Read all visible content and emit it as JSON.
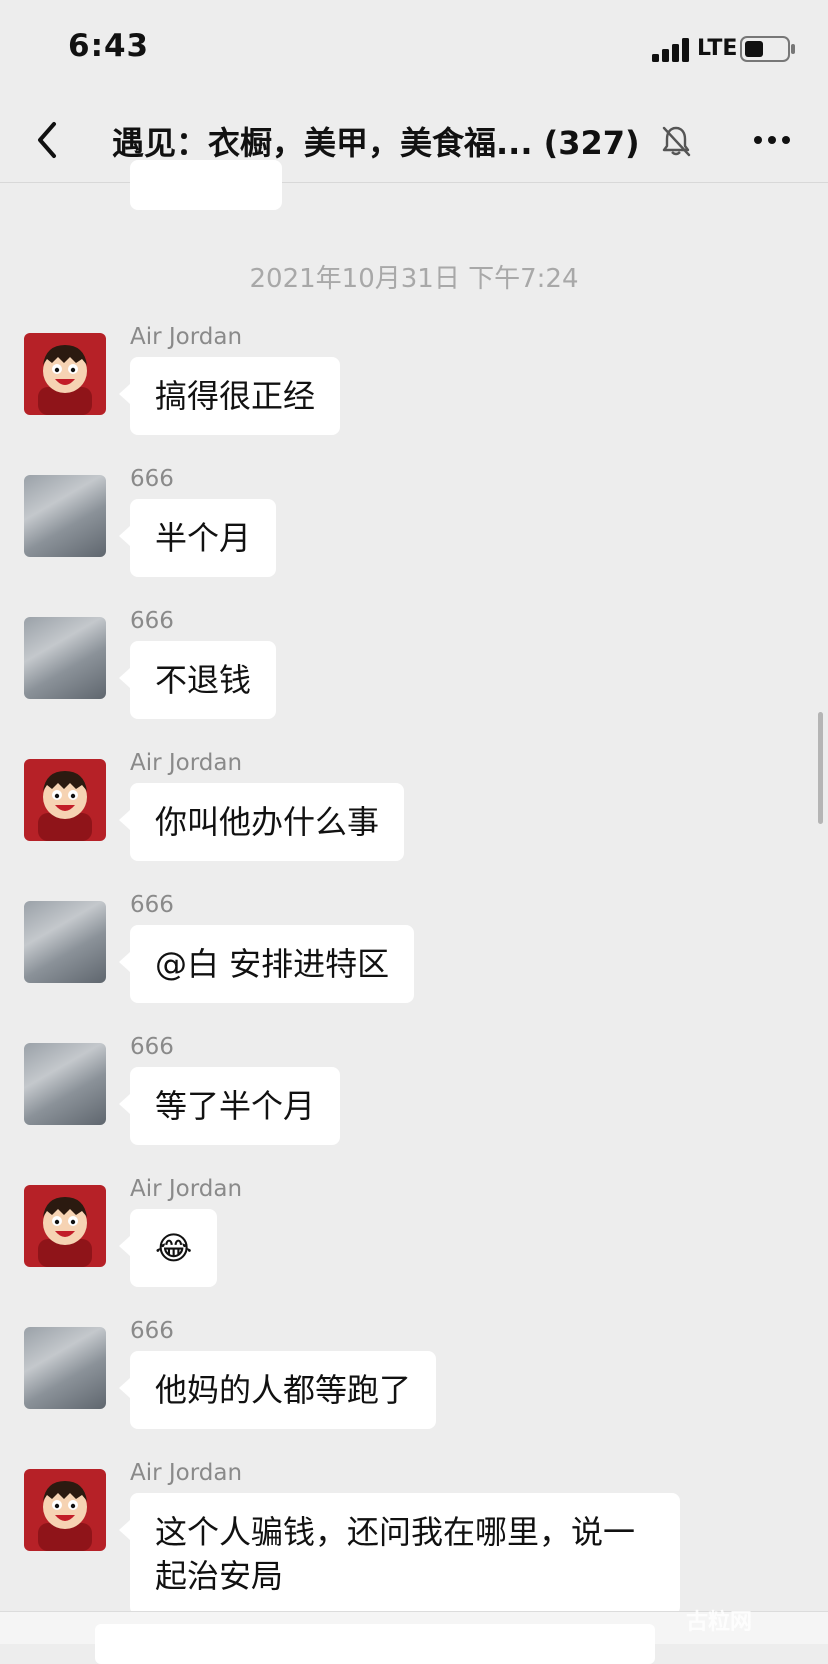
{
  "status_bar": {
    "time": "6:43",
    "network": "LTE",
    "signal_icon": "signal-bars-icon",
    "battery_icon": "battery-icon"
  },
  "nav": {
    "back_icon": "chevron-left-icon",
    "title": "遇见：衣橱，美甲，美食福... (327)",
    "mute_icon": "bell-muted-icon",
    "more_icon": "more-dots-icon"
  },
  "timestamp": "2021年10月31日 下午7:24",
  "messages": [
    {
      "sender": "Air Jordan",
      "text": "搞得很正经",
      "avatar": "cartoon-boy-avatar"
    },
    {
      "sender": "666",
      "text": "半个月",
      "avatar": "cloudy-sky-avatar"
    },
    {
      "sender": "666",
      "text": "不退钱",
      "avatar": "cloudy-sky-avatar"
    },
    {
      "sender": "Air Jordan",
      "text": "你叫他办什么事",
      "avatar": "cartoon-boy-avatar"
    },
    {
      "sender": "666",
      "text": "@白 安排进特区",
      "avatar": "cloudy-sky-avatar"
    },
    {
      "sender": "666",
      "text": "等了半个月",
      "avatar": "cloudy-sky-avatar"
    },
    {
      "sender": "Air Jordan",
      "text": "😂",
      "avatar": "cartoon-boy-avatar"
    },
    {
      "sender": "666",
      "text": "他妈的人都等跑了",
      "avatar": "cloudy-sky-avatar"
    },
    {
      "sender": "Air Jordan",
      "text": "这个人骗钱，还问我在哪里，说一起治安局",
      "avatar": "cartoon-boy-avatar"
    }
  ],
  "watermark": "古粒网"
}
